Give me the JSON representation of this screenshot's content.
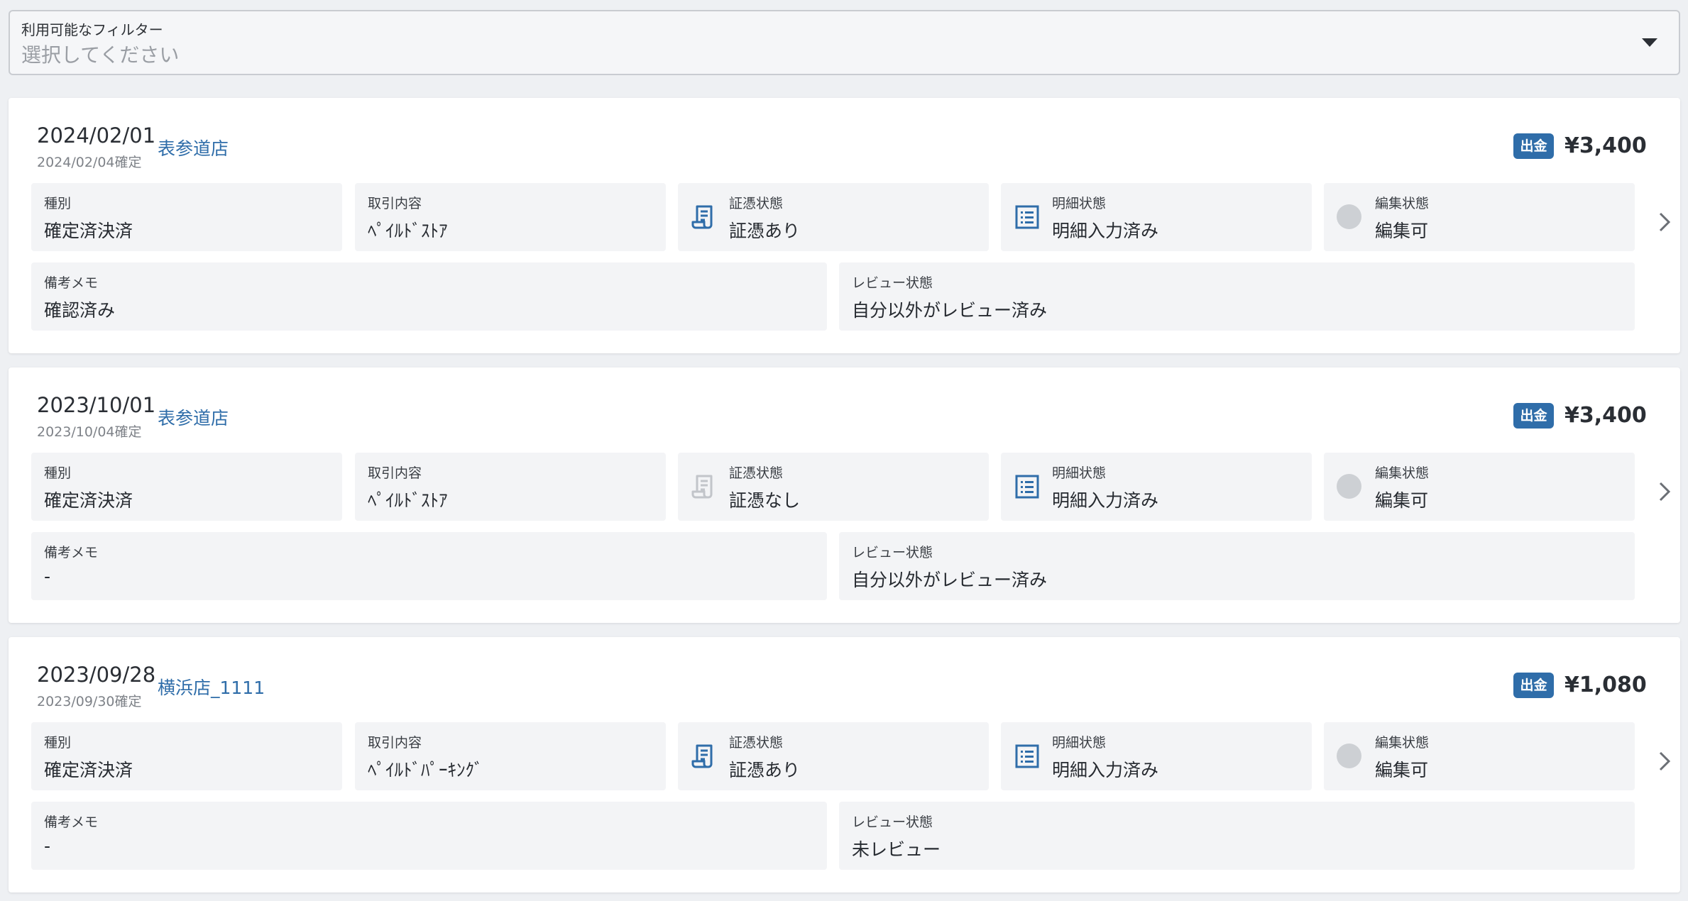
{
  "filter": {
    "label": "利用可能なフィルター",
    "placeholder": "選択してください"
  },
  "cards": [
    {
      "date": "2024/02/01",
      "confirm": "2024/02/04確定",
      "store": "表参道店",
      "badge": "出金",
      "amount": "¥3,400",
      "type_label": "種別",
      "type_value": "確定済決済",
      "content_label": "取引内容",
      "content_value": "ﾍﾟｲﾙﾄﾞｽﾄｱ",
      "voucher_label": "証憑状態",
      "voucher_value": "証憑あり",
      "voucher_icon": "receipt-icon",
      "detail_label": "明細状態",
      "detail_value": "明細入力済み",
      "edit_label": "編集状態",
      "edit_value": "編集可",
      "memo_label": "備考メモ",
      "memo_value": "確認済み",
      "review_label": "レビュー状態",
      "review_value": "自分以外がレビュー済み"
    },
    {
      "date": "2023/10/01",
      "confirm": "2023/10/04確定",
      "store": "表参道店",
      "badge": "出金",
      "amount": "¥3,400",
      "type_label": "種別",
      "type_value": "確定済決済",
      "content_label": "取引内容",
      "content_value": "ﾍﾟｲﾙﾄﾞｽﾄｱ",
      "voucher_label": "証憑状態",
      "voucher_value": "証憑なし",
      "voucher_icon": "receipt-disabled-icon",
      "detail_label": "明細状態",
      "detail_value": "明細入力済み",
      "edit_label": "編集状態",
      "edit_value": "編集可",
      "memo_label": "備考メモ",
      "memo_value": "-",
      "review_label": "レビュー状態",
      "review_value": "自分以外がレビュー済み"
    },
    {
      "date": "2023/09/28",
      "confirm": "2023/09/30確定",
      "store": "横浜店_1111",
      "badge": "出金",
      "amount": "¥1,080",
      "type_label": "種別",
      "type_value": "確定済決済",
      "content_label": "取引内容",
      "content_value": "ﾍﾟｲﾙﾄﾞﾊﾟｰｷﾝｸﾞ",
      "voucher_label": "証憑状態",
      "voucher_value": "証憑あり",
      "voucher_icon": "receipt-icon",
      "detail_label": "明細状態",
      "detail_value": "明細入力済み",
      "edit_label": "編集状態",
      "edit_value": "編集可",
      "memo_label": "備考メモ",
      "memo_value": "-",
      "review_label": "レビュー状態",
      "review_value": "未レビュー"
    }
  ],
  "colors": {
    "accent": "#2f6da9",
    "cell_bg": "#f3f4f6",
    "page_bg": "#eef0f3",
    "icon_disabled": "#c2c5ca"
  }
}
